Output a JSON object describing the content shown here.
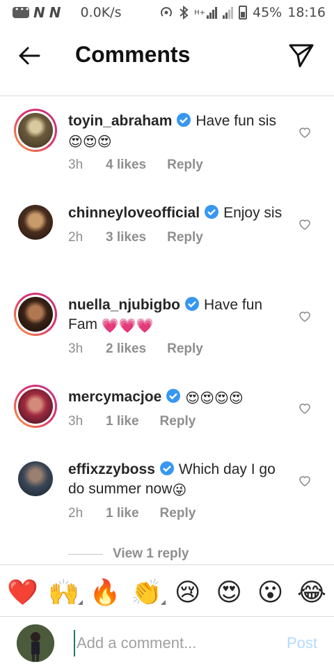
{
  "status_bar": {
    "n1": "N",
    "n2": "N",
    "speed": "0.0K/s",
    "network": "H+",
    "battery": "45%",
    "time": "18:16"
  },
  "header": {
    "title": "Comments"
  },
  "comments": [
    {
      "username": "toyin_abraham",
      "text": "Have fun sis",
      "emoji": "😍😍😍",
      "time": "3h",
      "likes": "4 likes",
      "reply": "Reply"
    },
    {
      "username": "chinneyloveofficial",
      "text": "Enjoy sis",
      "emoji": "",
      "time": "2h",
      "likes": "3 likes",
      "reply": "Reply"
    },
    {
      "username": "nuella_njubigbo",
      "text": "Have fun Fam",
      "emoji": "💗💗💗",
      "time": "3h",
      "likes": "2 likes",
      "reply": "Reply"
    },
    {
      "username": "mercymacjoe",
      "text": "",
      "emoji": "😍😍😍😍",
      "time": "3h",
      "likes": "1 like",
      "reply": "Reply"
    },
    {
      "username": "effixzzyboss",
      "text": "Which day I go do summer now",
      "emoji": "😜",
      "time": "2h",
      "likes": "1 like",
      "reply": "Reply"
    }
  ],
  "view_replies": "View 1 reply",
  "reactions": [
    "❤️",
    "🙌",
    "🔥",
    "👏",
    "😢",
    "😍",
    "😮",
    "😂"
  ],
  "composer": {
    "placeholder": "Add a comment...",
    "post_label": "Post"
  },
  "colors": {
    "verified": "#3897f0",
    "muted": "#8e8e8e",
    "post": "#b3dbff"
  }
}
